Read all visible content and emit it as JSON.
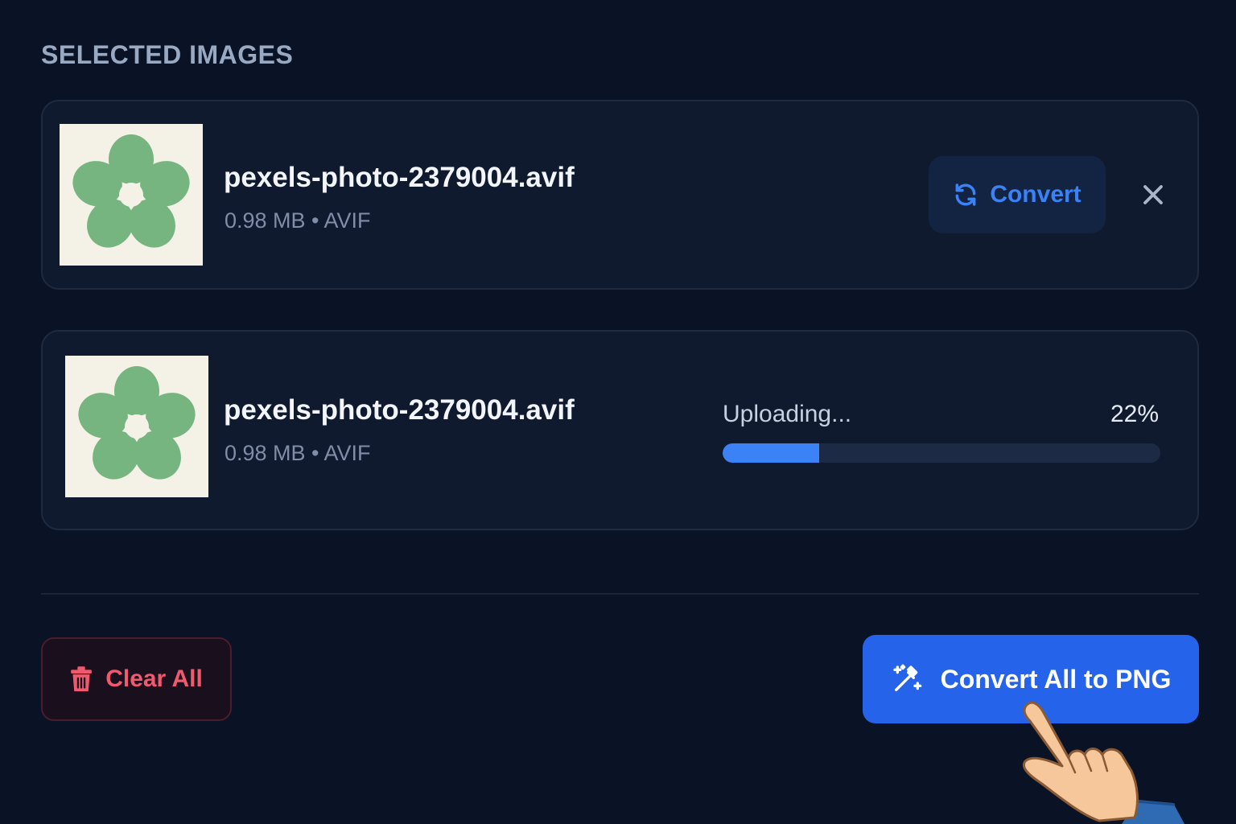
{
  "section_title": "SELECTED IMAGES",
  "files": [
    {
      "name": "pexels-photo-2379004.avif",
      "meta": "0.98 MB • AVIF",
      "convert_label": "Convert"
    },
    {
      "name": "pexels-photo-2379004.avif",
      "meta": "0.98 MB • AVIF",
      "status": "Uploading...",
      "progress_text": "22%",
      "progress_fraction": 0.22
    }
  ],
  "actions": {
    "clear_label": "Clear All",
    "convert_all_label": "Convert All to PNG"
  },
  "colors": {
    "background": "#0a1326",
    "card": "#101a2e",
    "accent": "#2563eb",
    "accent_text": "#3b82f6",
    "danger": "#f15a6e",
    "flower": "#76b57f"
  },
  "icons": [
    "flower-thumbnail",
    "refresh-icon",
    "close-icon",
    "trash-icon",
    "magic-wand-icon",
    "pointer-hand-icon"
  ]
}
